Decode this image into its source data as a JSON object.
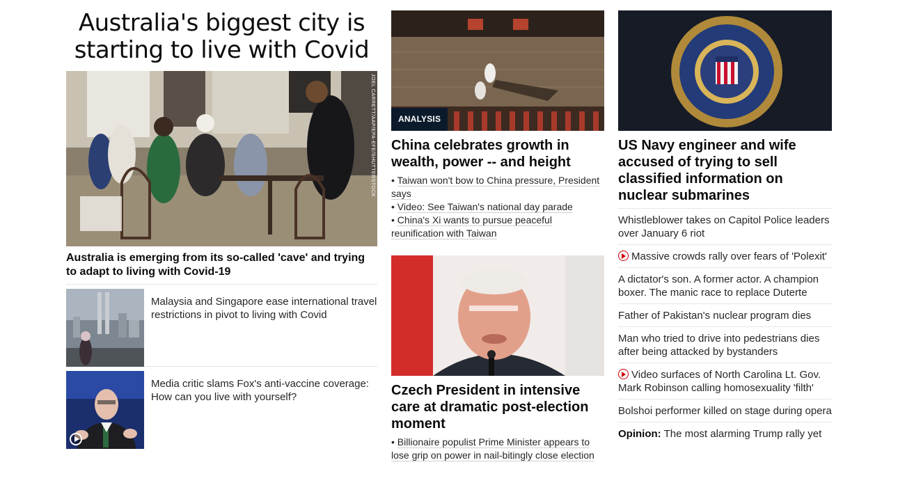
{
  "col1": {
    "headline": "Australia's biggest city is starting to live with Covid",
    "hero_credit": "JOEL CARRETT/AAP/EPA-EFE/SHUTTERSTOCK",
    "hero_caption": "Australia is emerging from its so-called 'cave' and trying to adapt to living with Covid-19",
    "stories": [
      {
        "text": "Malaysia and Singapore ease international travel restrictions in pivot to living with Covid"
      },
      {
        "text": "Media critic slams Fox's anti-vaccine coverage: How can you live with yourself?"
      }
    ]
  },
  "col2": {
    "top": {
      "label": "ANALYSIS",
      "headline": "China celebrates growth in wealth, power -- and height",
      "bullets": [
        "Taiwan won't bow to China pressure, President says",
        "Video: See Taiwan's national day parade",
        "China's Xi wants to pursue peaceful reunification with Taiwan"
      ]
    },
    "bottom": {
      "headline": "Czech President in intensive care at dramatic post-election moment",
      "bullets": [
        "Billionaire populist Prime Minister appears to lose grip on power in nail-bitingly close election"
      ]
    }
  },
  "col3": {
    "headline": "US Navy engineer and wife accused of trying to sell classified information on nuclear submarines",
    "items": [
      {
        "text": "Whistleblower takes on Capitol Police leaders over January 6 riot",
        "video": false
      },
      {
        "text": "Massive crowds rally over fears of 'Polexit'",
        "video": true
      },
      {
        "text": "A dictator's son. A former actor. A champion boxer. The manic race to replace Duterte",
        "video": false
      },
      {
        "text": "Father of Pakistan's nuclear program dies",
        "video": false
      },
      {
        "text": "Man who tried to drive into pedestrians dies after being attacked by bystanders",
        "video": false
      },
      {
        "text": "Video surfaces of North Carolina Lt. Gov. Mark Robinson calling homosexuality 'filth'",
        "video": true
      },
      {
        "text": "Bolshoi performer killed on stage during opera",
        "video": false
      }
    ],
    "opinion": {
      "label": "Opinion:",
      "text": "The most alarming Trump rally yet"
    }
  }
}
